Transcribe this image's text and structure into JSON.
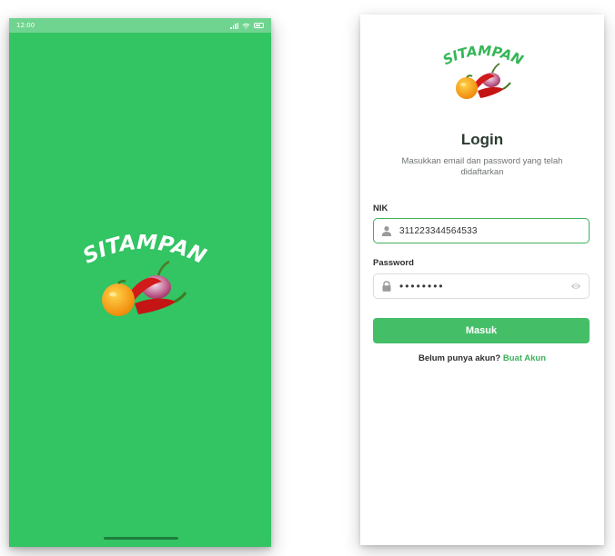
{
  "splash": {
    "status_time": "12:00",
    "background_color": "#33c463",
    "logo_text": "SITAMPAN"
  },
  "login": {
    "logo_text": "SITAMPAN",
    "title": "Login",
    "subtitle": "Masukkan email dan password yang telah didaftarkan",
    "nik_label": "NIK",
    "nik_value": "311223344564533",
    "password_label": "Password",
    "password_masked": "••••••••",
    "submit_label": "Masuk",
    "register_prompt": "Belum punya akun?",
    "register_link": "Buat Akun",
    "accent_color": "#45be68"
  }
}
